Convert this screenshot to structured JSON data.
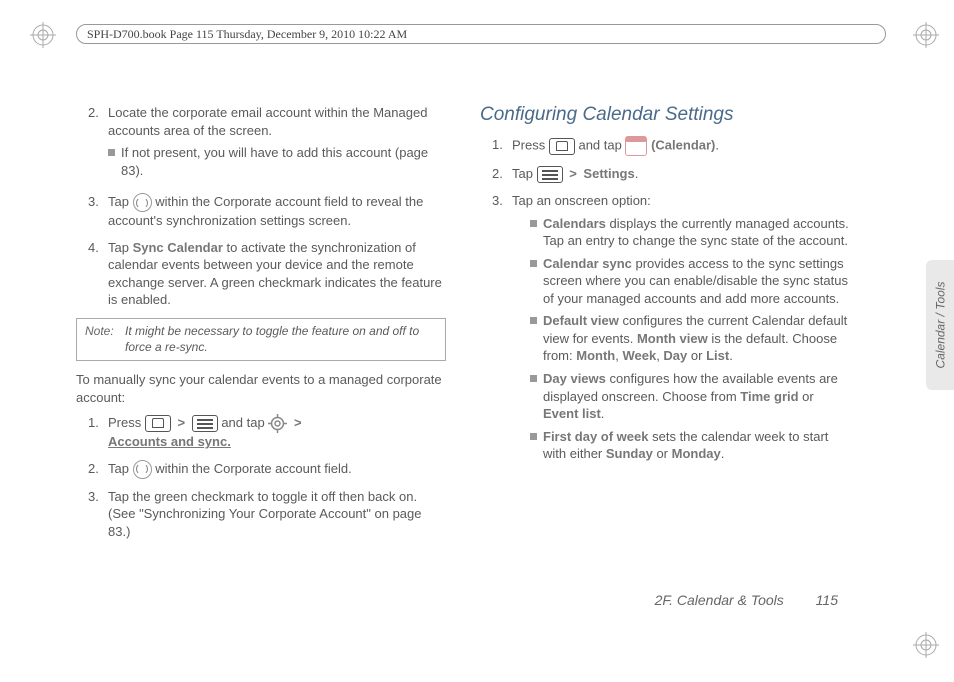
{
  "header": "SPH-D700.book  Page 115  Thursday, December 9, 2010  10:22 AM",
  "left": {
    "i2": "Locate the corporate email account within the Managed accounts area of the screen.",
    "i2_sub": "If not present, you will have to add this account (page 83).",
    "i3_a": "Tap ",
    "i3_b": " within the Corporate account field to reveal the account's synchronization settings screen.",
    "i4_a": "Tap ",
    "i4_bold": "Sync Calendar",
    "i4_b": " to activate the synchronization of calendar events between your device and the remote exchange server. A green checkmark indicates the feature is enabled.",
    "note_label": "Note:",
    "note": "It might be necessary to toggle the feature on and off to force a re-sync.",
    "para": "To manually sync your calendar events to a managed corporate account:",
    "m1_a": "Press ",
    "m1_b": " and tap ",
    "m1_link": "Accounts and sync.",
    "m2_a": "Tap ",
    "m2_b": " within the Corporate account field.",
    "m3": "Tap the green checkmark to toggle it off then back on. (See \"Synchronizing Your Corporate Account\" on page 83.)"
  },
  "right": {
    "title": "Configuring Calendar Settings",
    "r1_a": "Press ",
    "r1_b": " and tap ",
    "r1_bold": " (Calendar)",
    "r2_a": "Tap ",
    "r2_bold": "Settings",
    "r3": "Tap an onscreen option:",
    "b1_bold": "Calendars",
    "b1": " displays the currently managed accounts. Tap an entry to change the sync state of the account.",
    "b2_bold": "Calendar sync",
    "b2": " provides access to the sync settings screen where you can enable/disable the sync status of your managed accounts and add more accounts.",
    "b3_bold": "Default view",
    "b3_a": " configures the current Calendar default view for events. ",
    "b3_mv": "Month view",
    "b3_b": " is the default. Choose from: ",
    "b3_o1": "Month",
    "b3_o2": "Week",
    "b3_o3": "Day",
    "b3_o4": "List",
    "b4_bold": "Day views",
    "b4_a": " configures how the available events are displayed onscreen. Choose from ",
    "b4_o1": "Time grid",
    "b4_o2": "Event list",
    "b5_bold": "First day of week",
    "b5_a": " sets the calendar week to start with either ",
    "b5_o1": "Sunday",
    "b5_o2": "Monday"
  },
  "sidetab": "Calendar / Tools",
  "footer_section": "2F. Calendar & Tools",
  "footer_page": "115"
}
